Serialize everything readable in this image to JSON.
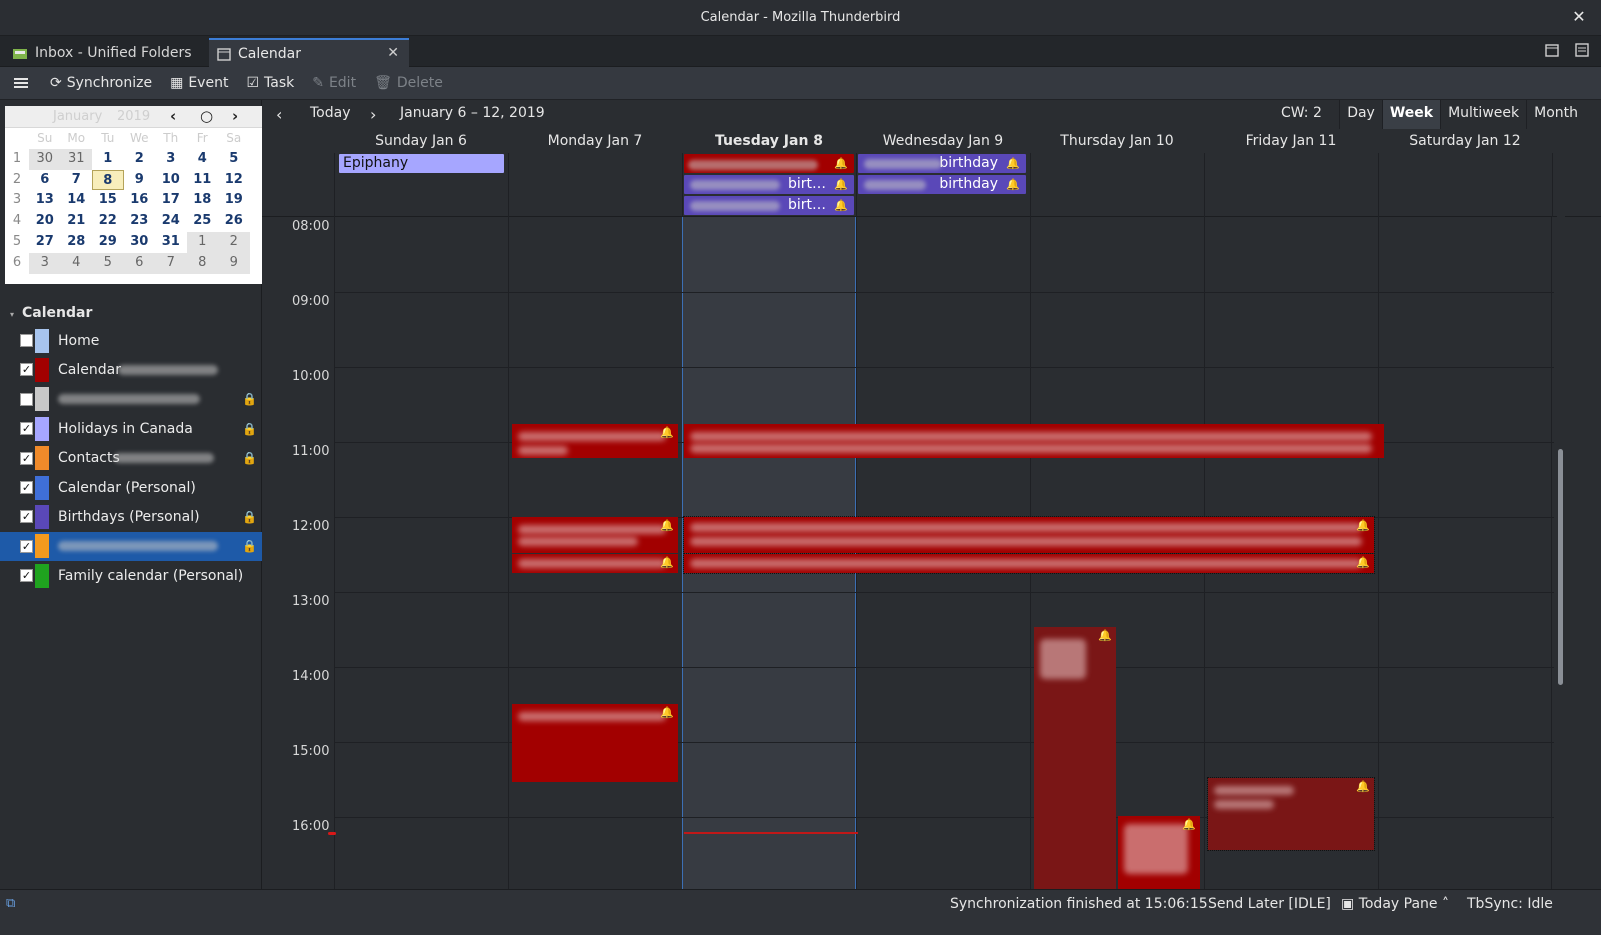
{
  "window": {
    "title": "Calendar - Mozilla Thunderbird"
  },
  "tabs": [
    {
      "label": "Inbox - Unified Folders"
    },
    {
      "label": "Calendar"
    }
  ],
  "toolbar": {
    "synchronize": "Synchronize",
    "event": "Event",
    "task": "Task",
    "edit": "Edit",
    "delete": "Delete"
  },
  "minimonth": {
    "month": "January",
    "year": "2019",
    "weekdays": [
      "Su",
      "Mo",
      "Tu",
      "We",
      "Th",
      "Fr",
      "Sa"
    ],
    "weeks": [
      {
        "wk": "1",
        "days": [
          "30",
          "31",
          "1",
          "2",
          "3",
          "4",
          "5"
        ]
      },
      {
        "wk": "2",
        "days": [
          "6",
          "7",
          "8",
          "9",
          "10",
          "11",
          "12"
        ]
      },
      {
        "wk": "3",
        "days": [
          "13",
          "14",
          "15",
          "16",
          "17",
          "18",
          "19"
        ]
      },
      {
        "wk": "4",
        "days": [
          "20",
          "21",
          "22",
          "23",
          "24",
          "25",
          "26"
        ]
      },
      {
        "wk": "5",
        "days": [
          "27",
          "28",
          "29",
          "30",
          "31",
          "1",
          "2"
        ]
      },
      {
        "wk": "6",
        "days": [
          "3",
          "4",
          "5",
          "6",
          "7",
          "8",
          "9"
        ]
      }
    ],
    "today": "8"
  },
  "calendar_list": {
    "title": "Calendar",
    "items": [
      {
        "name": "Home",
        "checked": false,
        "color": "#a7c4ee",
        "readonly": false
      },
      {
        "name": "Calendar",
        "checked": true,
        "color": "#a20000",
        "readonly": false
      },
      {
        "name": "",
        "checked": false,
        "color": "#c8c8c8",
        "readonly": true
      },
      {
        "name": "Holidays in Canada",
        "checked": true,
        "color": "#a6a6ff",
        "readonly": true
      },
      {
        "name": "Contacts",
        "checked": true,
        "color": "#f08a2a",
        "readonly": true
      },
      {
        "name": "Calendar (Personal)",
        "checked": true,
        "color": "#3f6fd8",
        "readonly": false
      },
      {
        "name": "Birthdays (Personal)",
        "checked": true,
        "color": "#5a48b8",
        "readonly": true
      },
      {
        "name": "",
        "checked": true,
        "color": "#f49a1e",
        "readonly": true,
        "selected": true
      },
      {
        "name": "Family calendar (Personal)",
        "checked": true,
        "color": "#1fa31f",
        "readonly": false
      }
    ]
  },
  "view": {
    "today": "Today",
    "range": "January 6 – 12, 2019",
    "cw": "CW: 2",
    "modes": [
      "Day",
      "Week",
      "Multiweek",
      "Month"
    ],
    "active_mode": "Week",
    "days": [
      "Sunday Jan 6",
      "Monday Jan 7",
      "Tuesday Jan 8",
      "Wednesday Jan 9",
      "Thursday Jan 10",
      "Friday Jan 11",
      "Saturday Jan 12"
    ],
    "today_index": 2,
    "hours": [
      "08:00",
      "09:00",
      "10:00",
      "11:00",
      "12:00",
      "13:00",
      "14:00",
      "15:00",
      "16:00"
    ]
  },
  "allday_events": {
    "epiphany": "Epiphany",
    "tue_birt_1": "birt…",
    "tue_birt_2": "birt…",
    "wed_birthday_1": "birthday",
    "wed_birthday_2": "birthday"
  },
  "colors": {
    "event_red": "#a20000",
    "event_dark_red": "#7a1616",
    "holiday_purple": "#a6a6ff",
    "birthday_purple": "#5a48b8",
    "selection_blue": "#1e5aa8"
  },
  "status": {
    "sync": "Synchronization finished at 15:06:15",
    "send_later": "Send Later [IDLE]",
    "today_pane": "Today Pane",
    "tbsync": "TbSync: Idle"
  }
}
